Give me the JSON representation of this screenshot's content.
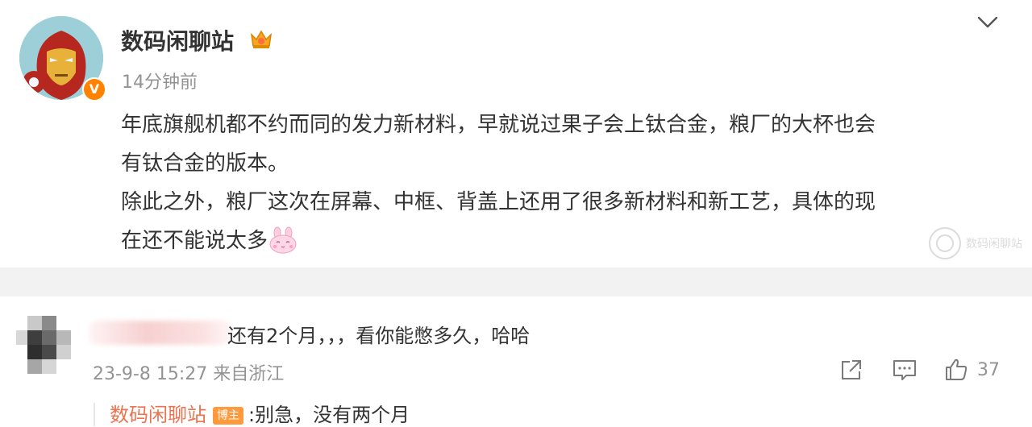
{
  "post": {
    "author": "数码闲聊站",
    "author_verified_badge": "V",
    "time": "14分钟前",
    "paragraphs": [
      "年底旗舰机都不约而同的发力新材料，早就说过果子会上钛合金，粮厂的大杯也会",
      "有钛合金的版本。",
      "除此之外，粮厂这次在屏幕、中框、背盖上还用了很多新材料和新工艺，具体的现",
      "在还不能说太多"
    ],
    "emoji": "rabbit-emoji",
    "watermark": "数码闲聊站",
    "icons": [
      "crown-icon",
      "chevron-down-icon"
    ],
    "colors": {
      "verify_badge": "#ff8200",
      "author_link": "#eb7350",
      "muted": "#939393"
    }
  },
  "comment": {
    "text": "还有2个月，，，看你能憋多久，哈哈",
    "meta": "23-9-8 15:27 来自浙江",
    "actions": {
      "share_icon": "share-icon",
      "comment_icon": "comment-icon",
      "like_icon": "like-icon",
      "like_count": "37"
    },
    "reply": {
      "author": "数码闲聊站",
      "tag": "博主",
      "text": ":别急，没有两个月"
    }
  }
}
